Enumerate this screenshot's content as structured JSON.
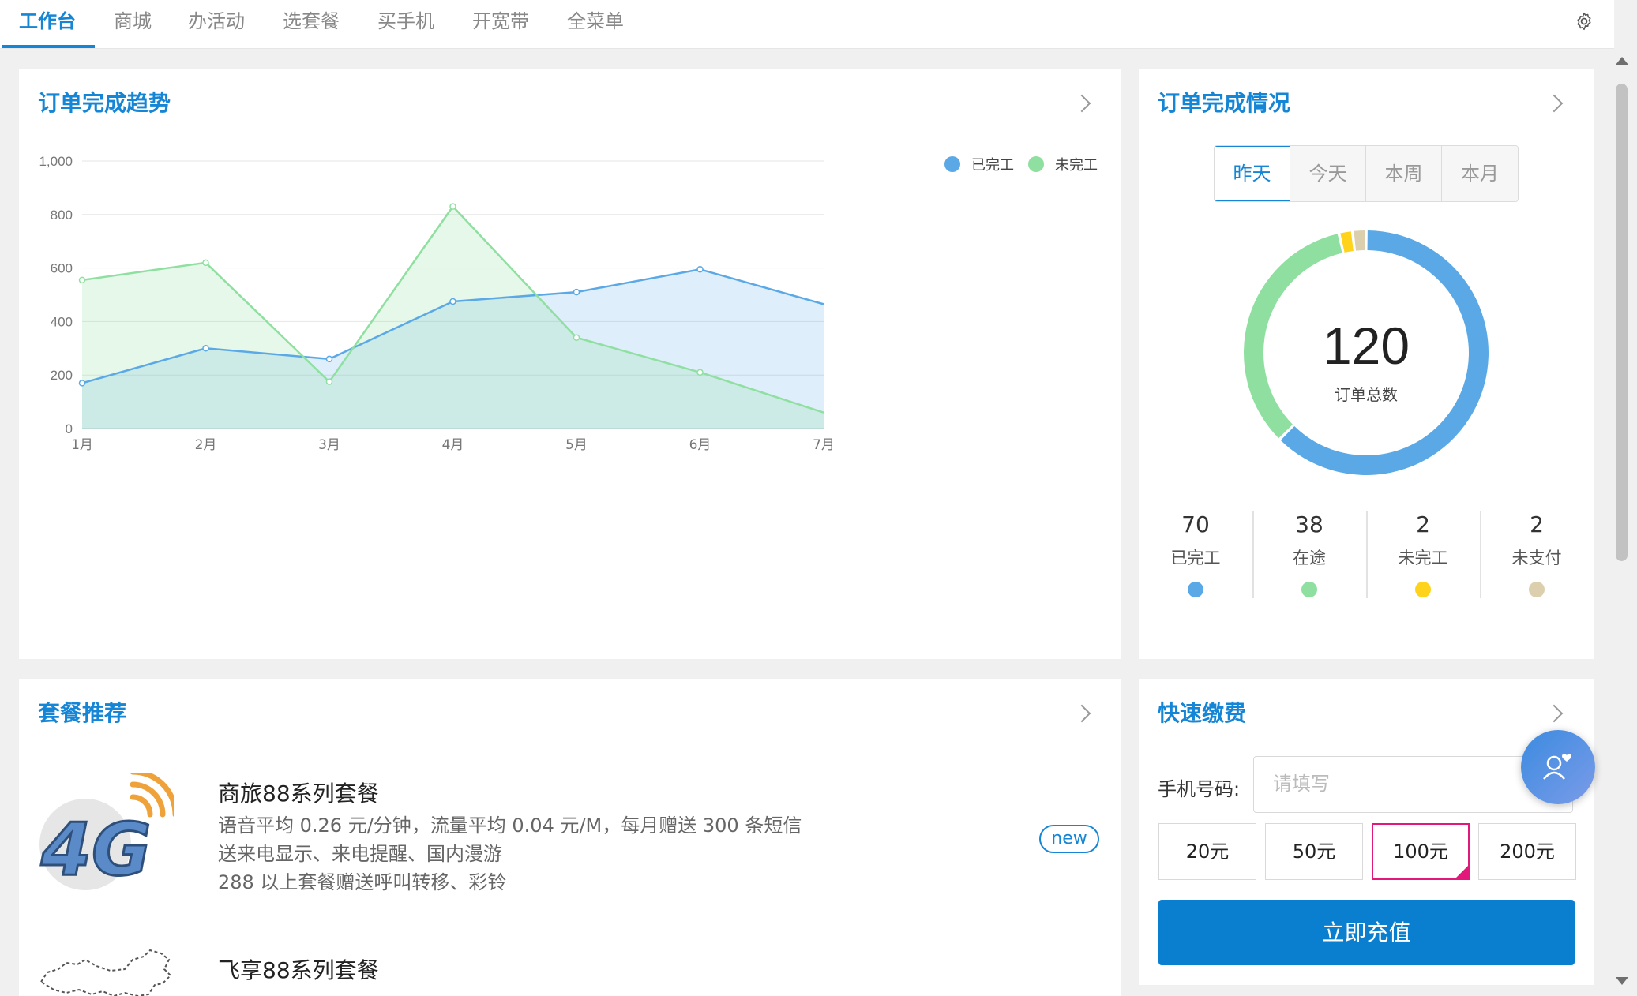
{
  "tabs": [
    {
      "label": "工作台",
      "active": true
    },
    {
      "label": "商城"
    },
    {
      "label": "办活动"
    },
    {
      "label": "选套餐"
    },
    {
      "label": "买手机"
    },
    {
      "label": "开宽带"
    },
    {
      "label": "全菜单"
    }
  ],
  "trend": {
    "title": "订单完成趋势",
    "chart_data": {
      "type": "area",
      "categories": [
        "1月",
        "2月",
        "3月",
        "4月",
        "5月",
        "6月",
        "7月"
      ],
      "series": [
        {
          "name": "已完工",
          "color": "#5aa9e6",
          "values": [
            170,
            300,
            260,
            475,
            510,
            595,
            465
          ]
        },
        {
          "name": "未完工",
          "color": "#8fe0a0",
          "values": [
            555,
            620,
            175,
            830,
            340,
            210,
            60
          ]
        }
      ],
      "ylim": [
        0,
        1000
      ],
      "yticks": [
        "1,000",
        "800",
        "600",
        "400",
        "200",
        "0"
      ],
      "grid": true,
      "legend": "top-right"
    }
  },
  "status": {
    "title": "订单完成情况",
    "ranges": [
      "昨天",
      "今天",
      "本周",
      "本月"
    ],
    "total": "120",
    "total_label": "订单总数",
    "chart_data": {
      "type": "pie",
      "slices": [
        {
          "label": "已完工",
          "value": 70,
          "color": "#5aa9e6"
        },
        {
          "label": "在途",
          "value": 38,
          "color": "#8fe0a0"
        },
        {
          "label": "未完工",
          "value": 2,
          "color": "#ffd21c"
        },
        {
          "label": "未支付",
          "value": 2,
          "color": "#dccfae"
        }
      ]
    },
    "stats": [
      {
        "value": "70",
        "label": "已完工",
        "color": "#5aa9e6"
      },
      {
        "value": "38",
        "label": "在途",
        "color": "#8fe0a0"
      },
      {
        "value": "2",
        "label": "未完工",
        "color": "#ffd21c"
      },
      {
        "value": "2",
        "label": "未支付",
        "color": "#dccfae"
      }
    ]
  },
  "packages": {
    "title": "套餐推荐",
    "items": [
      {
        "name": "商旅88系列套餐",
        "lines": [
          "语音平均 0.26 元/分钟，流量平均 0.04 元/M，每月赠送 300 条短信",
          "送来电显示、来电提醒、国内漫游",
          "288 以上套餐赠送呼叫转移、彩铃"
        ],
        "badge": "new",
        "image": "4g-logo-icon"
      },
      {
        "name": "飞享88系列套餐",
        "image": "china-map-icon"
      }
    ]
  },
  "payment": {
    "title": "快速缴费",
    "phone_label": "手机号码:",
    "phone_placeholder": "请填写",
    "amounts": [
      "20元",
      "50元",
      "100元",
      "200元"
    ],
    "selected_amount": "100元",
    "submit_label": "立即充值"
  }
}
